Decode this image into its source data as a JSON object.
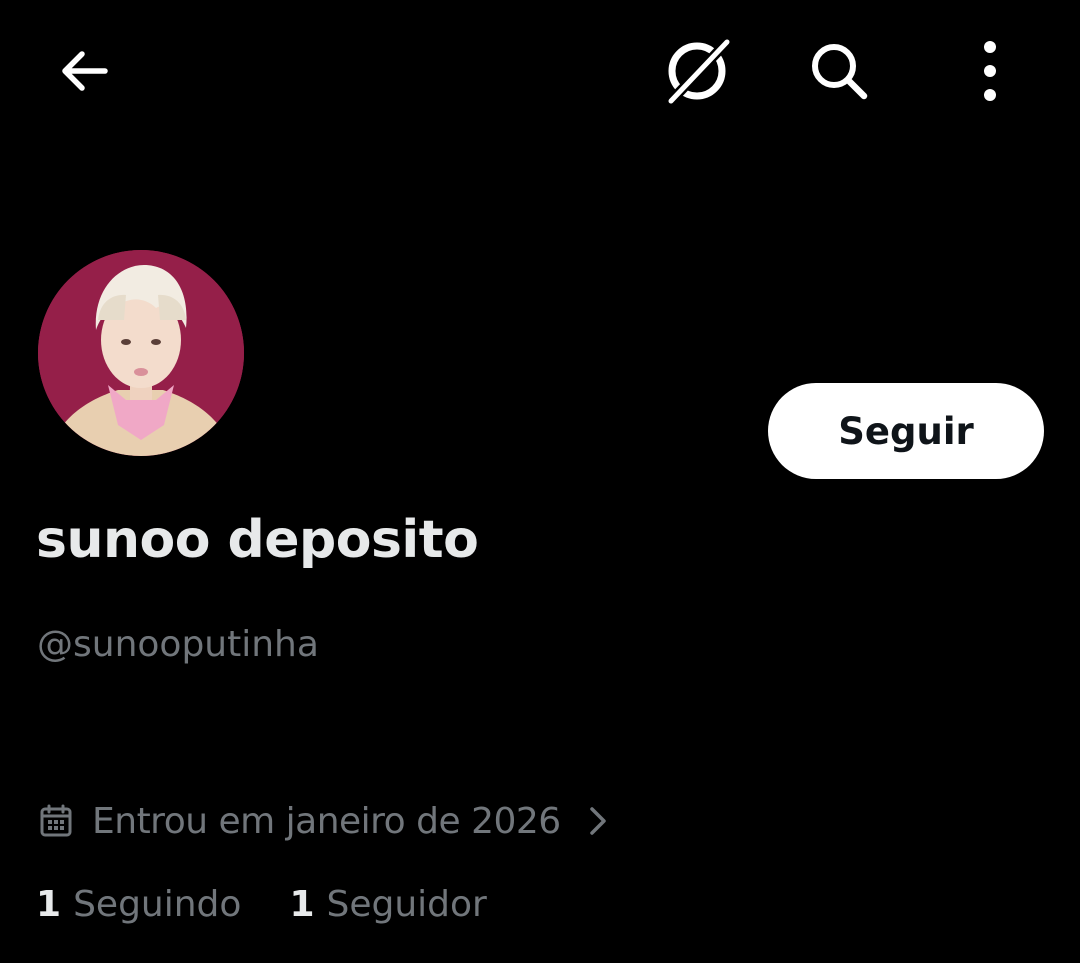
{
  "topbar": {
    "back_icon": "arrow-left-icon",
    "grok_icon": "grok-icon",
    "search_icon": "search-icon",
    "more_icon": "more-vertical-icon"
  },
  "profile": {
    "avatar_alt": "avatar",
    "display_name": "sunoo deposito",
    "handle": "@sunooputinha",
    "follow_label": "Seguir",
    "joined_icon": "calendar-icon",
    "joined_text": "Entrou em janeiro de 2026",
    "joined_chevron_icon": "chevron-right-icon"
  },
  "stats": {
    "following_count": "1",
    "following_label": "Seguindo",
    "followers_count": "1",
    "followers_label": "Seguidor"
  },
  "colors": {
    "background": "#000000",
    "primary_text": "#e7e9ea",
    "secondary_text": "#71767b",
    "button_bg": "#ffffff",
    "button_text": "#0f1419",
    "avatar_bg": "#8f1d45"
  }
}
